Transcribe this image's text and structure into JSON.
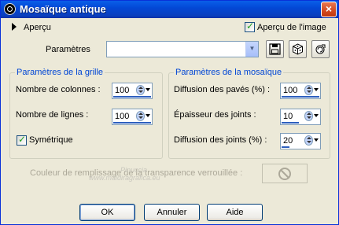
{
  "window": {
    "title": "Mosaïque antique",
    "close_glyph": "×",
    "title_icon": "app-icon"
  },
  "top": {
    "apercu_label": "Aperçu",
    "apercu_image_label": "Aperçu de l'image",
    "apercu_image_checked": true,
    "parametres_label": "Paramètres",
    "parametres_value": ""
  },
  "tools": {
    "save_icon": "save-icon",
    "random_icon": "dice-icon",
    "reset_icon": "reset-icon"
  },
  "grille": {
    "title": "Paramètres de la grille",
    "colonnes_label": "Nombre de colonnes :",
    "colonnes_value": "100",
    "lignes_label": "Nombre de lignes :",
    "lignes_value": "100",
    "symetrique_label": "Symétrique",
    "symetrique_checked": true
  },
  "mosaique": {
    "title": "Paramètres de la mosaïque",
    "diffusion_paves_label": "Diffusion des pavés (%) :",
    "diffusion_paves_value": "100",
    "epaisseur_label": "Épaisseur des joints :",
    "epaisseur_value": "10",
    "diffusion_joints_label": "Diffusion des joints (%) :",
    "diffusion_joints_value": "20"
  },
  "remplissage": {
    "label": "Couleur de remplissage de la transparence verrouillée :",
    "icon": "no-entry-icon"
  },
  "watermark": {
    "line1": "Pinuccia",
    "line2": "www.maldiragrafica.eu"
  },
  "buttons": {
    "ok": "OK",
    "annuler": "Annuler",
    "aide": "Aide"
  }
}
